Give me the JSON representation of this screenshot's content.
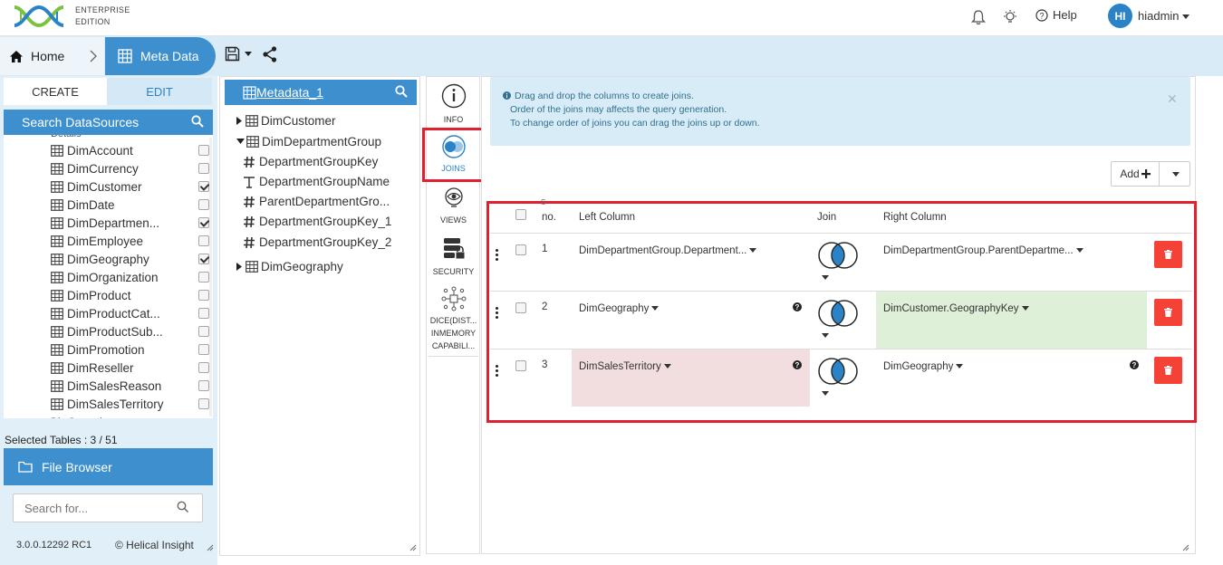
{
  "app": {
    "edition_line1": "ENTERPRISE",
    "edition_line2": "EDITION"
  },
  "topbar": {
    "help_label": "Help",
    "avatar_initials": "HI",
    "username": "hiadmin"
  },
  "breadcrumb": {
    "home": "Home",
    "current": "Meta Data"
  },
  "leftpanel": {
    "tab_create": "CREATE",
    "tab_edit": "EDIT",
    "search_title": "Search DataSources",
    "datasources": [
      {
        "label": "DimAccount",
        "checked": false
      },
      {
        "label": "DimCurrency",
        "checked": false
      },
      {
        "label": "DimCustomer",
        "checked": true
      },
      {
        "label": "DimDate",
        "checked": false
      },
      {
        "label": "DimDepartmen...",
        "checked": true
      },
      {
        "label": "DimEmployee",
        "checked": false
      },
      {
        "label": "DimGeography",
        "checked": true
      },
      {
        "label": "DimOrganization",
        "checked": false
      },
      {
        "label": "DimProduct",
        "checked": false
      },
      {
        "label": "DimProductCat...",
        "checked": false
      },
      {
        "label": "DimProductSub...",
        "checked": false
      },
      {
        "label": "DimPromotion",
        "checked": false
      },
      {
        "label": "DimReseller",
        "checked": false
      },
      {
        "label": "DimSalesReason",
        "checked": false
      },
      {
        "label": "DimSalesTerritory",
        "checked": false
      }
    ],
    "selected_tables": "Selected Tables : 3 / 51",
    "file_browser": "File Browser",
    "search_placeholder": "Search for...",
    "version": "3.0.0.12292 RC1",
    "copyright": "© Helical Insight"
  },
  "tree": {
    "title": "Metadata_1",
    "items": [
      {
        "label": "DimCustomer",
        "kind": "table-collapsed"
      },
      {
        "label": "DimDepartmentGroup",
        "kind": "table-expanded"
      },
      {
        "label": "DepartmentGroupKey",
        "kind": "numeric"
      },
      {
        "label": "DepartmentGroupName",
        "kind": "text"
      },
      {
        "label": "ParentDepartmentGro...",
        "kind": "numeric"
      },
      {
        "label": "DepartmentGroupKey_1",
        "kind": "numeric"
      },
      {
        "label": "DepartmentGroupKey_2",
        "kind": "numeric"
      },
      {
        "label": "DimGeography",
        "kind": "table-collapsed"
      }
    ]
  },
  "sidetabs": {
    "info": "INFO",
    "joins": "JOINS",
    "views": "VIEWS",
    "security": "SECURITY",
    "dice_1": "DICE(DIST...",
    "dice_2": "INMEMORY",
    "dice_3": "CAPABILI..."
  },
  "main": {
    "info_line1": "Drag and drop the columns to create joins.",
    "info_line2": "Order of the joins may affects the query generation.",
    "info_line3": "To change order of joins you can drag the joins up or down.",
    "add_label": "Add",
    "columns": {
      "no_small": "S",
      "no": "no.",
      "left": "Left Column",
      "join": "Join",
      "right": "Right Column"
    },
    "joins": [
      {
        "no": "1",
        "left": "DimDepartmentGroup.Department...",
        "right": "DimDepartmentGroup.ParentDepartme...",
        "left_status": "ok",
        "right_status": "ok"
      },
      {
        "no": "2",
        "left": "DimGeography",
        "right": "DimCustomer.GeographyKey",
        "left_status": "warn",
        "right_status": "valid"
      },
      {
        "no": "3",
        "left": "DimSalesTerritory",
        "right": "DimGeography",
        "left_status": "invalid",
        "right_status": "warn"
      }
    ],
    "colors": {
      "accent": "#3d8fcd",
      "danger": "#f44236",
      "valid_bg": "#dff0d8",
      "invalid_bg": "#f2dede",
      "highlight": "#e0202e"
    }
  }
}
